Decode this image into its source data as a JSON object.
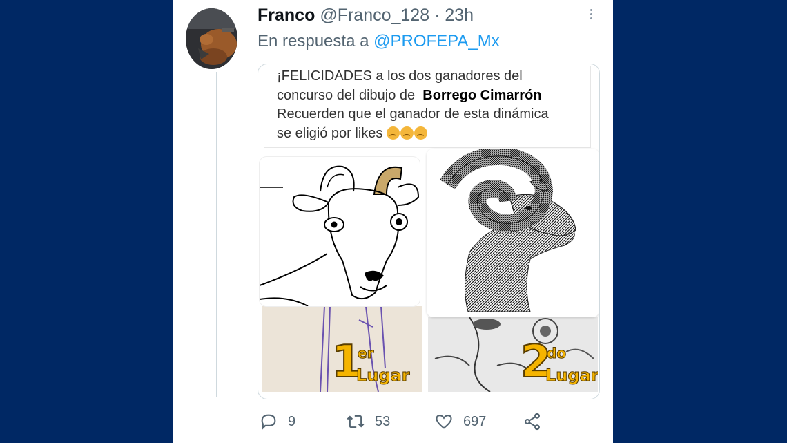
{
  "tweet": {
    "author_name": "Franco",
    "handle": "@Franco_128",
    "separator": "·",
    "time": "23h",
    "reply_prefix": "En respuesta a",
    "reply_mention": "@PROFEPA_Mx"
  },
  "image": {
    "caption_lines": [
      "¡FELICIDADES a los dos ganadores del",
      "concurso del dibujo de",
      "Borrego Cimarrón",
      "Recuerden que el ganador de esta dinámica",
      "se eligió por likes"
    ],
    "first_place": {
      "number": "1",
      "sup": "er",
      "word": "Lugar"
    },
    "second_place": {
      "number": "2",
      "sup": "do",
      "word": "Lugar"
    }
  },
  "actions": {
    "replies": "9",
    "retweets": "53",
    "likes": "697"
  },
  "icons": [
    "more-icon",
    "reply-icon",
    "retweet-icon",
    "like-icon",
    "share-icon"
  ],
  "colors": {
    "background": "#002864",
    "mention": "#1d9bf0",
    "muted": "#536471",
    "gold": "#f5b400"
  }
}
